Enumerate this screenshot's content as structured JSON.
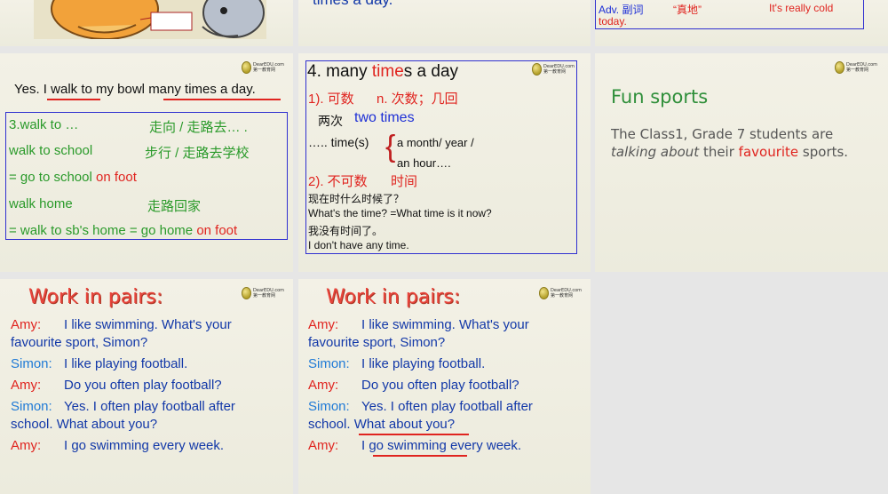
{
  "top_middle": {
    "line": "times a day."
  },
  "top_right": {
    "adv": "Adv. 副词",
    "meaning": "“真地”",
    "example": "It's really cold",
    "example2": "today."
  },
  "slide_walk": {
    "sentence_a": "Yes. I ",
    "sentence_b": "walk to",
    "sentence_c": " my bowl ",
    "sentence_d": "many times a day.",
    "rows": [
      {
        "en": "3.walk to …",
        "cn": "走向 / 走路去… ."
      },
      {
        "en": "walk to school",
        "cn": "步行 / 走路去学校"
      },
      {
        "en": "= go to school ",
        "en_red": "on foot",
        "cn": ""
      },
      {
        "en": " walk home",
        "cn": "走路回家"
      },
      {
        "en": "= walk to sb's home = go home ",
        "en_red": "on foot",
        "cn": ""
      }
    ]
  },
  "slide_times": {
    "heading_a": "4. many ",
    "heading_red": "time",
    "heading_b": "s a day",
    "c1": "1). 可数",
    "c1b": "n.  次数；几回",
    "twice_cn": "两次",
    "twice_en": "two times",
    "dots": "….. time(s)",
    "brace_1": "a  month/ year /",
    "brace_2": "an hour….",
    "c2": "2).  不可数",
    "c2b": "时间",
    "l1": "现在时什么时候了？",
    "l2": "What's the time?  =What time is it now?",
    "l3": "我没有时间了。",
    "l4": "I don't have any time."
  },
  "slide_fun": {
    "title": "Fun sports",
    "line1": "The Class1, Grade 7 students are",
    "line2_a": "talking about",
    "line2_b": " their ",
    "line2_c": "favourite",
    "line2_d": " sports."
  },
  "pairs": {
    "title": "Work in pairs:",
    "amy": "Amy:",
    "simon": "Simon:",
    "a1": "I like swimming. What's your",
    "a1b": "favourite sport, Simon?",
    "s1": "I like playing football.",
    "a2": "Do you often play football?",
    "s2": "Yes. I often play football after",
    "s2b": "school. What about you?",
    "a3": "I go swimming every week."
  },
  "logo": {
    "l1": "DearEDU.com",
    "l2": "第一教育网"
  }
}
